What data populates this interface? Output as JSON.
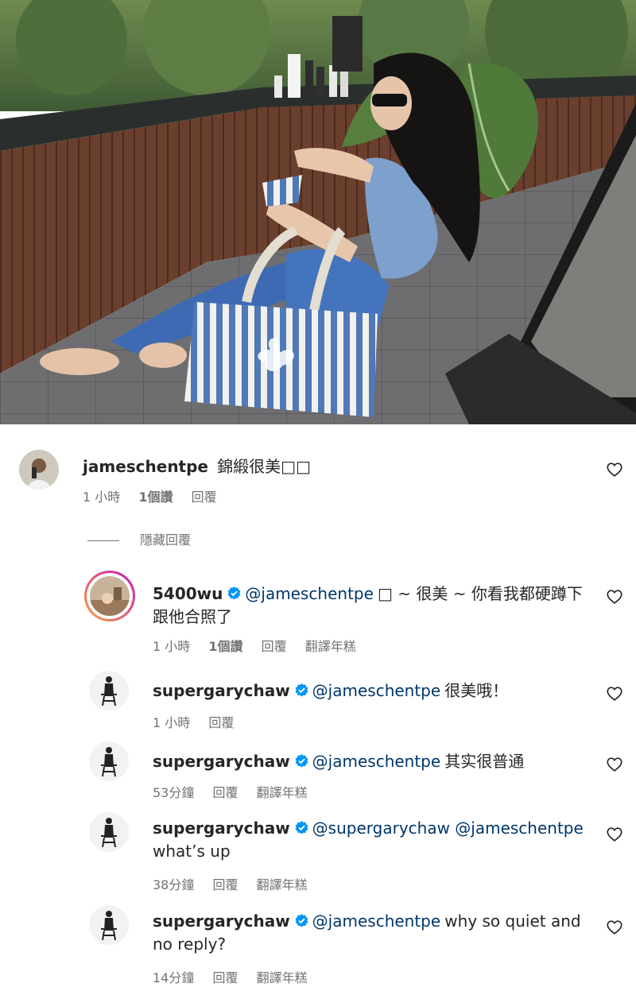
{
  "comments": [
    {
      "username": "jameschentpe",
      "verified": false,
      "mention": "",
      "text_line1": "錦緞很美□□",
      "text_line2": "",
      "time": "1 小時",
      "likes": "1個讚",
      "reply": "回覆",
      "translate": ""
    }
  ],
  "hide_replies_label": "隱藏回覆",
  "replies": [
    {
      "username": "5400wu",
      "verified": true,
      "mention": "@jameschentpe",
      "text_line1": "□ ~ 很美 ~ 你看我都硬蹲下",
      "text_line2": "跟他合照了",
      "time": "1 小時",
      "likes": "1個讚",
      "reply": "回覆",
      "translate": "翻譯年糕"
    },
    {
      "username": "supergarychaw",
      "verified": true,
      "mention": "@jameschentpe",
      "text_line1": "很美哦！",
      "text_line2": "",
      "time": "1 小時",
      "likes": "",
      "reply": "回覆",
      "translate": ""
    },
    {
      "username": "supergarychaw",
      "verified": true,
      "mention": "@jameschentpe",
      "text_line1": "其实很普通",
      "text_line2": "",
      "time": "53分鐘",
      "likes": "",
      "reply": "回覆",
      "translate": "翻譯年糕"
    },
    {
      "username": "supergarychaw",
      "verified": true,
      "mention": "@supergarychaw @jameschentpe",
      "text_line1": "",
      "text_line2": "what’s up",
      "time": "38分鐘",
      "likes": "",
      "reply": "回覆",
      "translate": "翻譯年糕"
    },
    {
      "username": "supergarychaw",
      "verified": true,
      "mention": "@jameschentpe",
      "text_line1": "why so quiet and",
      "text_line2": "no reply?",
      "time": "14分鐘",
      "likes": "",
      "reply": "回覆",
      "translate": "翻譯年糕"
    }
  ],
  "icons": {
    "like": "heart-outline-icon",
    "verified": "verified-badge-icon"
  },
  "colors": {
    "mention": "#00376b",
    "verified": "#0095f6",
    "meta": "#737373",
    "story_ring_start": "#f9a03f",
    "story_ring_end": "#c913b9"
  }
}
